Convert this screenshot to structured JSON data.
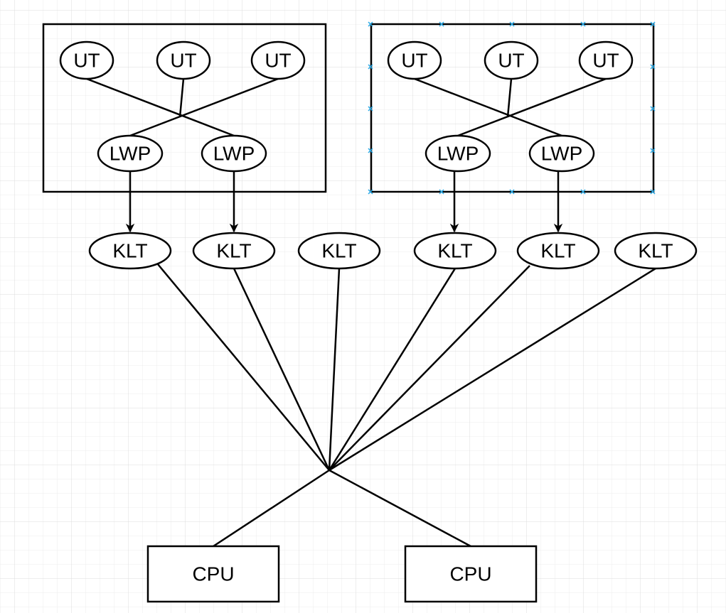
{
  "diagram": {
    "groups": [
      {
        "id": "process-1",
        "user_threads": [
          "UT",
          "UT",
          "UT"
        ],
        "lwps": [
          "LWP",
          "LWP"
        ],
        "selected": false
      },
      {
        "id": "process-2",
        "user_threads": [
          "UT",
          "UT",
          "UT"
        ],
        "lwps": [
          "LWP",
          "LWP"
        ],
        "selected": true
      }
    ],
    "kernel_threads": [
      "KLT",
      "KLT",
      "KLT",
      "KLT",
      "KLT",
      "KLT"
    ],
    "cpus": [
      "CPU",
      "CPU"
    ],
    "colors": {
      "selection": "#29a9e6",
      "grid": "#e6e6e6",
      "stroke": "#000000"
    }
  }
}
